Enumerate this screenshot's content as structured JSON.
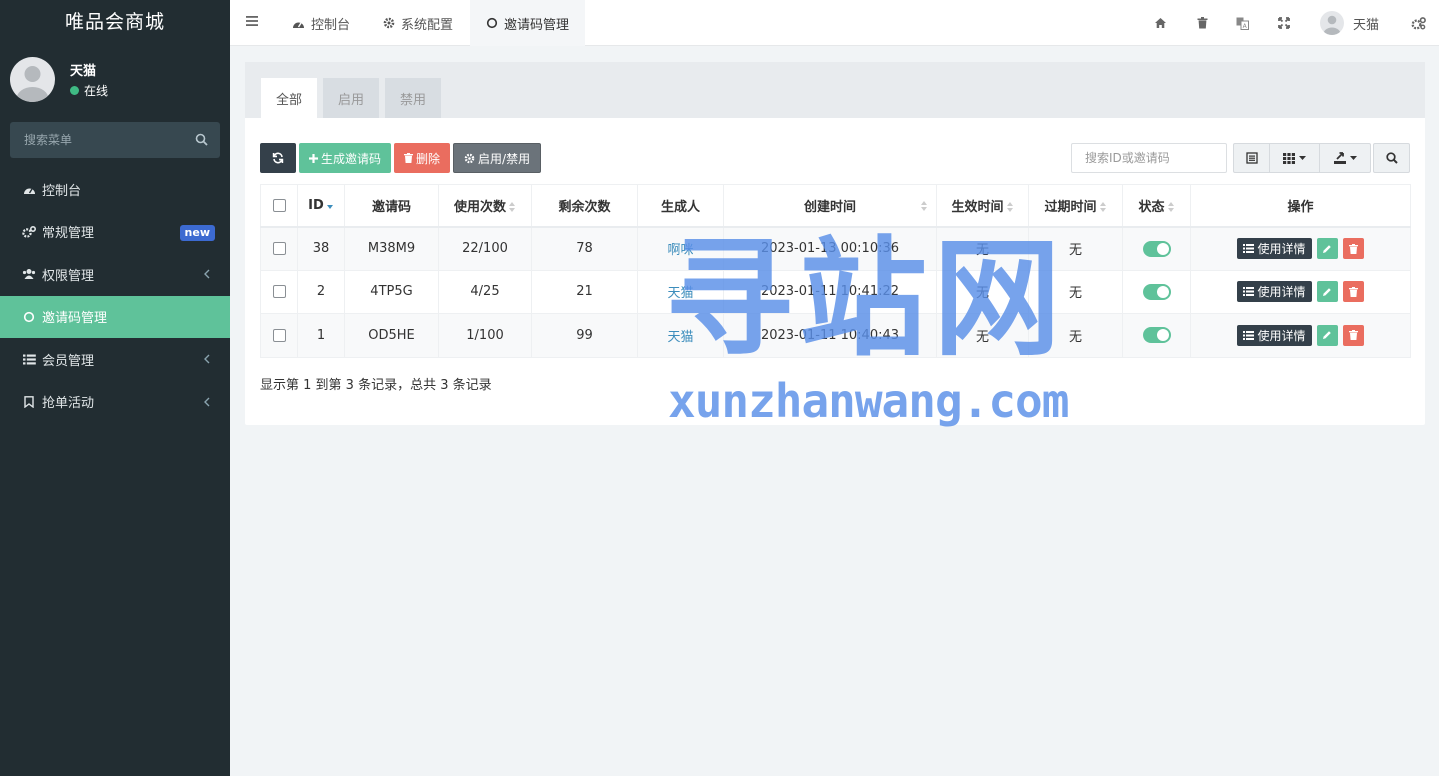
{
  "brand": "唯品会商城",
  "user": {
    "name": "天猫",
    "status": "在线"
  },
  "sidebar": {
    "search_placeholder": "搜索菜单",
    "items": [
      {
        "label": "控制台",
        "icon": "dashboard-icon"
      },
      {
        "label": "常规管理",
        "icon": "cogs-icon",
        "badge": "new"
      },
      {
        "label": "权限管理",
        "icon": "group-icon"
      },
      {
        "label": "邀请码管理",
        "icon": "circle-icon",
        "active": true
      },
      {
        "label": "会员管理",
        "icon": "list-icon"
      },
      {
        "label": "抢单活动",
        "icon": "bookmark-icon"
      }
    ]
  },
  "topnav": {
    "tabs": [
      {
        "label": "控制台",
        "icon": "dashboard-icon"
      },
      {
        "label": "系统配置",
        "icon": "gear-icon"
      },
      {
        "label": "邀请码管理",
        "icon": "circle-icon",
        "active": true
      }
    ],
    "user_name": "天猫"
  },
  "panel": {
    "tabs": [
      "全部",
      "启用",
      "禁用"
    ],
    "toolbar": {
      "generate": "生成邀请码",
      "delete": "删除",
      "toggle": "启用/禁用"
    },
    "search_placeholder": "搜索ID或邀请码"
  },
  "table": {
    "columns": [
      "ID",
      "邀请码",
      "使用次数",
      "剩余次数",
      "生成人",
      "创建时间",
      "生效时间",
      "过期时间",
      "状态",
      "操作"
    ],
    "rows": [
      {
        "id": "38",
        "code": "M38M9",
        "used": "22/100",
        "remain": "78",
        "creator": "啊咪",
        "created": "2023-01-13 00:10:36",
        "effective": "无",
        "expire": "无",
        "enabled": true
      },
      {
        "id": "2",
        "code": "4TP5G",
        "used": "4/25",
        "remain": "21",
        "creator": "天猫",
        "created": "2023-01-11 10:41:22",
        "effective": "无",
        "expire": "无",
        "enabled": true
      },
      {
        "id": "1",
        "code": "OD5HE",
        "used": "1/100",
        "remain": "99",
        "creator": "天猫",
        "created": "2023-01-11 10:40:43",
        "effective": "无",
        "expire": "无",
        "enabled": true
      }
    ],
    "detail_label": "使用详情"
  },
  "pager_info": "显示第 1 到第 3 条记录，总共 3 条记录",
  "watermark": {
    "main": "寻站网",
    "sub": "xunzhanwang.com"
  },
  "colors": {
    "sidebar_bg": "#222d32",
    "accent_green": "#5fc29a",
    "danger": "#ea6d5f",
    "dark_btn": "#34404a",
    "badge_blue": "#3c6ad1"
  }
}
